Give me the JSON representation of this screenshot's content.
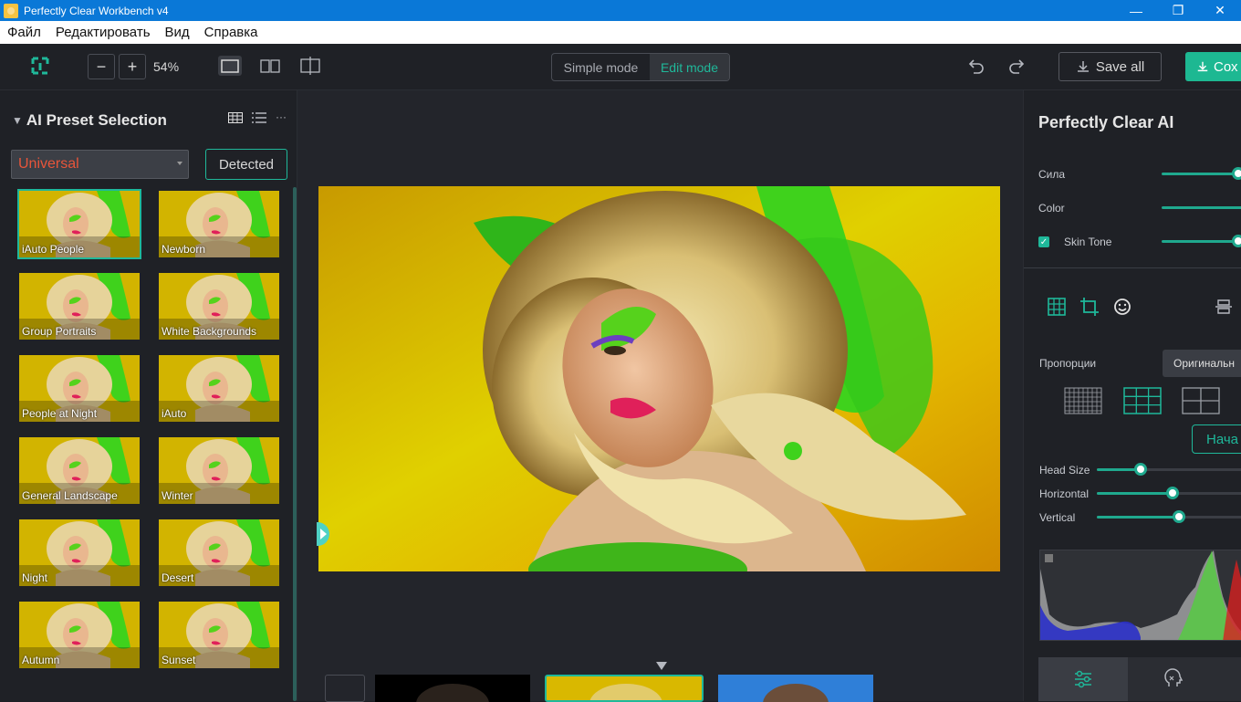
{
  "window": {
    "title": "Perfectly Clear Workbench v4"
  },
  "menu": {
    "items": [
      "Файл",
      "Редактировать",
      "Вид",
      "Справка"
    ]
  },
  "toolbar": {
    "zoom": "54%",
    "mode_simple": "Simple mode",
    "mode_edit": "Edit mode",
    "save_all": "Save all",
    "save_green": "Сох"
  },
  "left_panel": {
    "title": "AI Preset Selection",
    "preset_value": "Universal",
    "detected_label": "Detected",
    "presets": [
      "iAuto People",
      "Newborn",
      "Group Portraits",
      "White Backgrounds",
      "People at Night",
      "iAuto",
      "General Landscape",
      "Winter",
      "Night",
      "Desert",
      "Autumn",
      "Sunset"
    ]
  },
  "right_panel": {
    "title": "Perfectly Clear AI",
    "strength_label": "Сила",
    "color_label": "Color",
    "skin_tone_label": "Skin Tone",
    "proportions_label": "Пропорции",
    "aspect_value": "Оригинальн",
    "start_label": "Нача",
    "head_size_label": "Head Size",
    "horizontal_label": "Horizontal",
    "vertical_label": "Vertical",
    "head_size_value": 0.3,
    "horizontal_value": 0.52,
    "vertical_value": 0.56
  },
  "colors": {
    "accent": "#1fb89a",
    "title_bar": "#0a78d7",
    "preset_text": "#e8553a"
  }
}
